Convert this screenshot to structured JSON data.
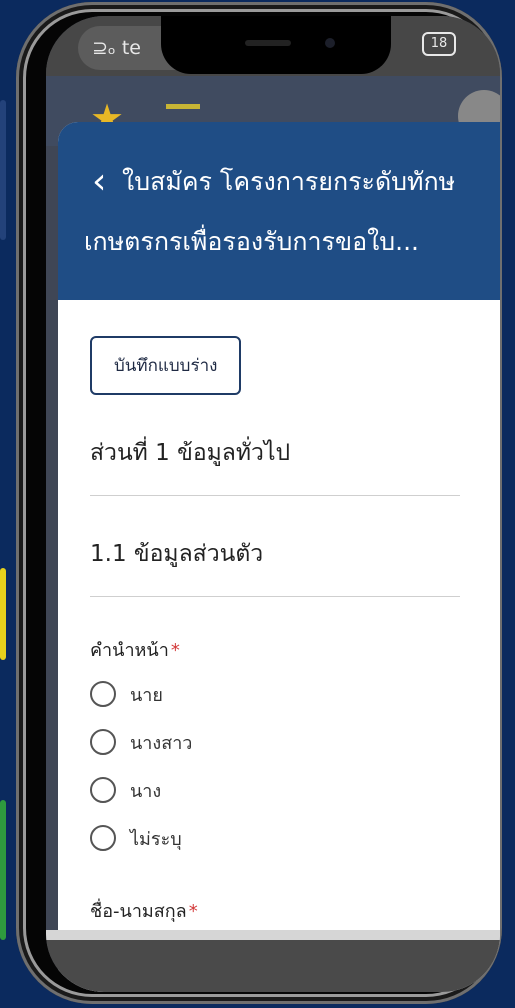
{
  "status": {
    "left_text": "⊇ₒ te",
    "battery": "18"
  },
  "header": {
    "title_line1": "ใบสมัคร โครงการยกระดับทักษ",
    "title_line2": "เกษตรกรเพื่อรองรับการขอใบ..."
  },
  "form": {
    "save_draft_label": "บันทึกแบบร่าง",
    "section_title": "ส่วนที่ 1 ข้อมูลทั่วไป",
    "subsection_title": "1.1 ข้อมูลส่วนตัว",
    "prefix_label": "คำนำหน้า",
    "required_mark": "*",
    "prefix_options": [
      "นาย",
      "นางสาว",
      "นาง",
      "ไม่ระบุ"
    ],
    "name_label": "ชื่อ-นามสกุล"
  },
  "colors": {
    "header_bg": "#1f4d85",
    "background": "#0b2a5e",
    "required": "#d33a3a"
  },
  "icons": {
    "back": "chevron-left-icon"
  }
}
